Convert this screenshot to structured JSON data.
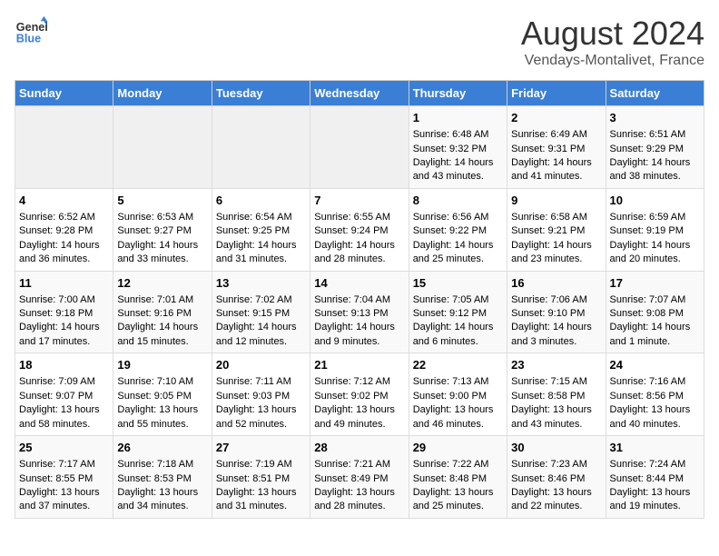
{
  "header": {
    "logo_general": "General",
    "logo_blue": "Blue",
    "title": "August 2024",
    "subtitle": "Vendays-Montalivet, France"
  },
  "days_of_week": [
    "Sunday",
    "Monday",
    "Tuesday",
    "Wednesday",
    "Thursday",
    "Friday",
    "Saturday"
  ],
  "weeks": [
    [
      {
        "day": "",
        "empty": true
      },
      {
        "day": "",
        "empty": true
      },
      {
        "day": "",
        "empty": true
      },
      {
        "day": "",
        "empty": true
      },
      {
        "day": "1",
        "sunrise": "6:48 AM",
        "sunset": "9:32 PM",
        "daylight": "14 hours and 43 minutes."
      },
      {
        "day": "2",
        "sunrise": "6:49 AM",
        "sunset": "9:31 PM",
        "daylight": "14 hours and 41 minutes."
      },
      {
        "day": "3",
        "sunrise": "6:51 AM",
        "sunset": "9:29 PM",
        "daylight": "14 hours and 38 minutes."
      }
    ],
    [
      {
        "day": "4",
        "sunrise": "6:52 AM",
        "sunset": "9:28 PM",
        "daylight": "14 hours and 36 minutes."
      },
      {
        "day": "5",
        "sunrise": "6:53 AM",
        "sunset": "9:27 PM",
        "daylight": "14 hours and 33 minutes."
      },
      {
        "day": "6",
        "sunrise": "6:54 AM",
        "sunset": "9:25 PM",
        "daylight": "14 hours and 31 minutes."
      },
      {
        "day": "7",
        "sunrise": "6:55 AM",
        "sunset": "9:24 PM",
        "daylight": "14 hours and 28 minutes."
      },
      {
        "day": "8",
        "sunrise": "6:56 AM",
        "sunset": "9:22 PM",
        "daylight": "14 hours and 25 minutes."
      },
      {
        "day": "9",
        "sunrise": "6:58 AM",
        "sunset": "9:21 PM",
        "daylight": "14 hours and 23 minutes."
      },
      {
        "day": "10",
        "sunrise": "6:59 AM",
        "sunset": "9:19 PM",
        "daylight": "14 hours and 20 minutes."
      }
    ],
    [
      {
        "day": "11",
        "sunrise": "7:00 AM",
        "sunset": "9:18 PM",
        "daylight": "14 hours and 17 minutes."
      },
      {
        "day": "12",
        "sunrise": "7:01 AM",
        "sunset": "9:16 PM",
        "daylight": "14 hours and 15 minutes."
      },
      {
        "day": "13",
        "sunrise": "7:02 AM",
        "sunset": "9:15 PM",
        "daylight": "14 hours and 12 minutes."
      },
      {
        "day": "14",
        "sunrise": "7:04 AM",
        "sunset": "9:13 PM",
        "daylight": "14 hours and 9 minutes."
      },
      {
        "day": "15",
        "sunrise": "7:05 AM",
        "sunset": "9:12 PM",
        "daylight": "14 hours and 6 minutes."
      },
      {
        "day": "16",
        "sunrise": "7:06 AM",
        "sunset": "9:10 PM",
        "daylight": "14 hours and 3 minutes."
      },
      {
        "day": "17",
        "sunrise": "7:07 AM",
        "sunset": "9:08 PM",
        "daylight": "14 hours and 1 minute."
      }
    ],
    [
      {
        "day": "18",
        "sunrise": "7:09 AM",
        "sunset": "9:07 PM",
        "daylight": "13 hours and 58 minutes."
      },
      {
        "day": "19",
        "sunrise": "7:10 AM",
        "sunset": "9:05 PM",
        "daylight": "13 hours and 55 minutes."
      },
      {
        "day": "20",
        "sunrise": "7:11 AM",
        "sunset": "9:03 PM",
        "daylight": "13 hours and 52 minutes."
      },
      {
        "day": "21",
        "sunrise": "7:12 AM",
        "sunset": "9:02 PM",
        "daylight": "13 hours and 49 minutes."
      },
      {
        "day": "22",
        "sunrise": "7:13 AM",
        "sunset": "9:00 PM",
        "daylight": "13 hours and 46 minutes."
      },
      {
        "day": "23",
        "sunrise": "7:15 AM",
        "sunset": "8:58 PM",
        "daylight": "13 hours and 43 minutes."
      },
      {
        "day": "24",
        "sunrise": "7:16 AM",
        "sunset": "8:56 PM",
        "daylight": "13 hours and 40 minutes."
      }
    ],
    [
      {
        "day": "25",
        "sunrise": "7:17 AM",
        "sunset": "8:55 PM",
        "daylight": "13 hours and 37 minutes."
      },
      {
        "day": "26",
        "sunrise": "7:18 AM",
        "sunset": "8:53 PM",
        "daylight": "13 hours and 34 minutes."
      },
      {
        "day": "27",
        "sunrise": "7:19 AM",
        "sunset": "8:51 PM",
        "daylight": "13 hours and 31 minutes."
      },
      {
        "day": "28",
        "sunrise": "7:21 AM",
        "sunset": "8:49 PM",
        "daylight": "13 hours and 28 minutes."
      },
      {
        "day": "29",
        "sunrise": "7:22 AM",
        "sunset": "8:48 PM",
        "daylight": "13 hours and 25 minutes."
      },
      {
        "day": "30",
        "sunrise": "7:23 AM",
        "sunset": "8:46 PM",
        "daylight": "13 hours and 22 minutes."
      },
      {
        "day": "31",
        "sunrise": "7:24 AM",
        "sunset": "8:44 PM",
        "daylight": "13 hours and 19 minutes."
      }
    ]
  ]
}
